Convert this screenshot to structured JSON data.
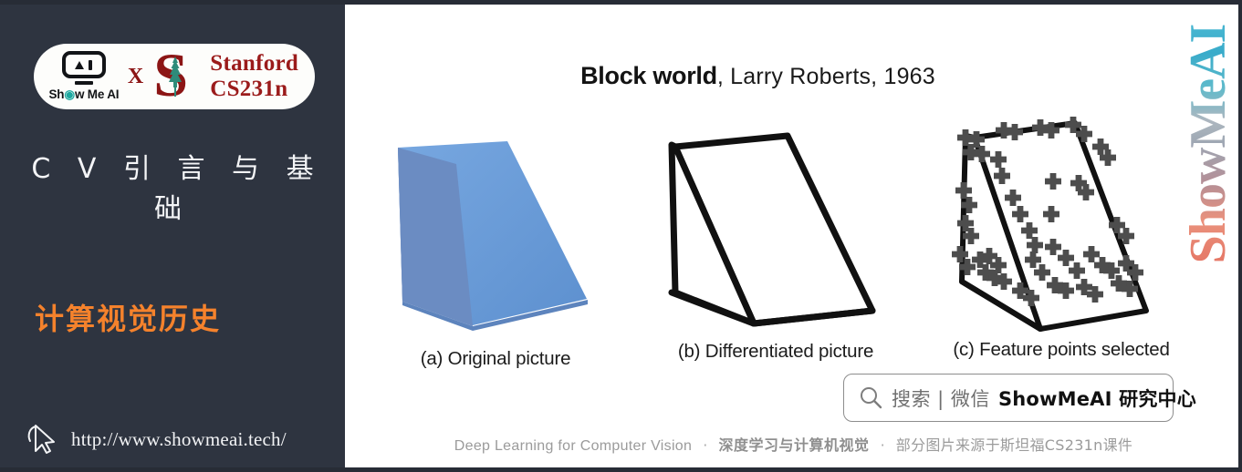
{
  "sidebar": {
    "badge": {
      "showmeai_label": "Show Me AI",
      "cross_label": "X",
      "stanford_letter": "S",
      "stanford_line1": "Stanford",
      "stanford_line2": "CS231n"
    },
    "title": "C V 引 言 与 基 础",
    "subtitle": "计算视觉历史",
    "url": "http://www.showmeai.tech/",
    "cursor_icon": "cursor-pointer-icon",
    "background_color": "#2e3440",
    "subtitle_color": "#f5822c"
  },
  "main": {
    "title_strong": "Block world",
    "title_light": ", Larry Roberts, 1963",
    "figures": [
      {
        "id": "a",
        "caption": "(a) Original picture",
        "kind": "shaded-3d-wedge",
        "colors": {
          "light_face": "#6fa0dc",
          "dark_face": "#6a8cc0",
          "mid_face": "#5f8fd0"
        }
      },
      {
        "id": "b",
        "caption": "(b) Differentiated picture",
        "kind": "line-drawing-wedge",
        "colors": {
          "stroke": "#111111",
          "fill": "#ffffff"
        }
      },
      {
        "id": "c",
        "caption": "(c) Feature points selected",
        "kind": "wireframe-with-feature-crosses",
        "colors": {
          "stroke": "#111111",
          "cross": "#4d4d4d"
        },
        "cross_count": 48
      }
    ],
    "watermark": "ShowMeAI",
    "search": {
      "icon": "search-icon",
      "hint": "搜索 | 微信",
      "brand": "ShowMeAI 研究中心"
    },
    "footer": {
      "en": "Deep Learning for Computer Vision",
      "sep": "·",
      "cn_strong": "深度学习与计算机视觉",
      "cn": "部分图片来源于斯坦福CS231n课件"
    }
  }
}
